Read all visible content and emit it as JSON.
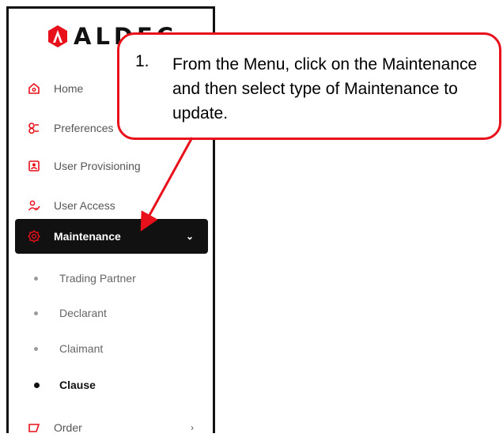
{
  "app": {
    "logo_text": "ALDEC"
  },
  "sidebar": {
    "items": [
      {
        "label": "Home",
        "icon": "home-icon"
      },
      {
        "label": "Preferences",
        "icon": "preferences-icon"
      },
      {
        "label": "User Provisioning",
        "icon": "user-provisioning-icon"
      },
      {
        "label": "User Access",
        "icon": "user-access-icon"
      },
      {
        "label": "Maintenance",
        "icon": "gear-icon",
        "active": true
      },
      {
        "label": "Order",
        "icon": "order-icon"
      }
    ],
    "maintenance_sub": [
      {
        "label": "Trading Partner"
      },
      {
        "label": "Declarant"
      },
      {
        "label": "Claimant"
      },
      {
        "label": "Clause",
        "current": true
      }
    ]
  },
  "callout": {
    "number": "1.",
    "text": "From the Menu, click on the Maintenance and then select type of Maintenance to update."
  },
  "colors": {
    "accent": "#e8101a",
    "active_bg": "#111111"
  }
}
